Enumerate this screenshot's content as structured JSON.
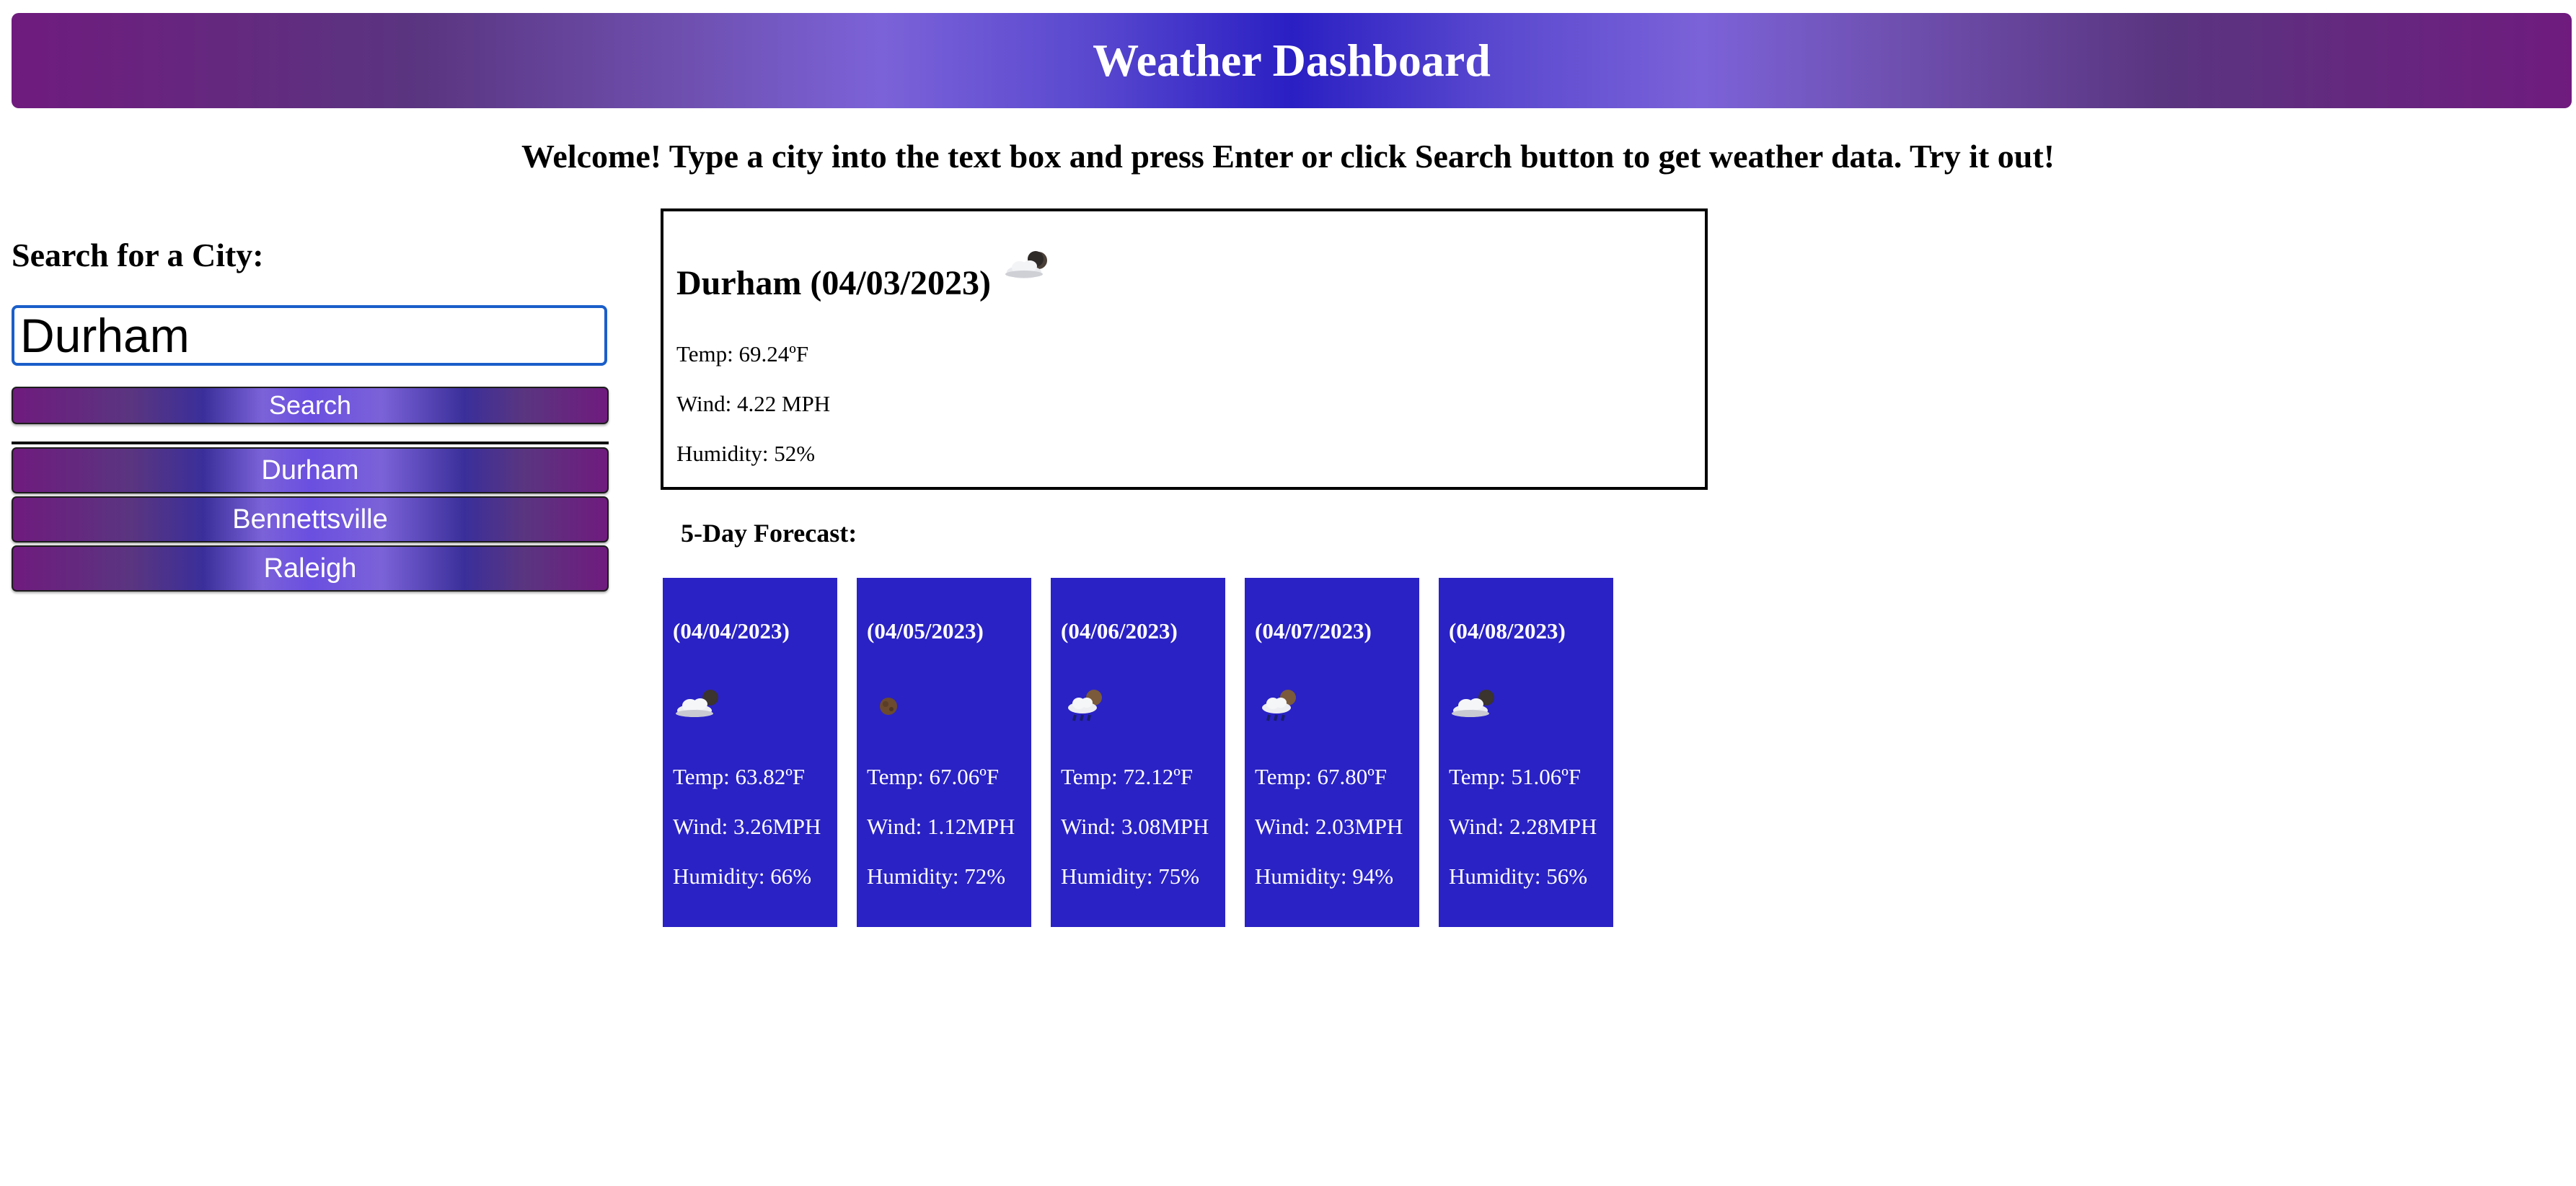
{
  "header": {
    "title": "Weather Dashboard"
  },
  "welcome": "Welcome! Type a city into the text box and press Enter or click Search button to get weather data. Try it out!",
  "search": {
    "title": "Search for a City:",
    "value": "Durham",
    "button_label": "Search"
  },
  "history": [
    {
      "label": "Durham"
    },
    {
      "label": "Bennettsville"
    },
    {
      "label": "Raleigh"
    }
  ],
  "current": {
    "title": "Durham (04/03/2023)",
    "icon": "cloud-moon-icon",
    "temp": "Temp: 69.24ºF",
    "wind": "Wind: 4.22 MPH",
    "humidity": "Humidity: 52%"
  },
  "forecast": {
    "title": "5-Day Forecast:",
    "days": [
      {
        "date": "(04/04/2023)",
        "icon": "cloud-moon-icon",
        "temp": "Temp: 63.82ºF",
        "wind": "Wind: 3.26MPH",
        "humidity": "Humidity: 66%"
      },
      {
        "date": "(04/05/2023)",
        "icon": "moon-icon",
        "temp": "Temp: 67.06ºF",
        "wind": "Wind: 1.12MPH",
        "humidity": "Humidity: 72%"
      },
      {
        "date": "(04/06/2023)",
        "icon": "rain-moon-icon",
        "temp": "Temp: 72.12ºF",
        "wind": "Wind: 3.08MPH",
        "humidity": "Humidity: 75%"
      },
      {
        "date": "(04/07/2023)",
        "icon": "rain-moon-icon",
        "temp": "Temp: 67.80ºF",
        "wind": "Wind: 2.03MPH",
        "humidity": "Humidity: 94%"
      },
      {
        "date": "(04/08/2023)",
        "icon": "cloud-moon-icon",
        "temp": "Temp: 51.06ºF",
        "wind": "Wind: 2.28MPH",
        "humidity": "Humidity: 56%"
      }
    ]
  },
  "colors": {
    "card_bg": "#2a22c4",
    "input_border": "#1a5ec9"
  }
}
